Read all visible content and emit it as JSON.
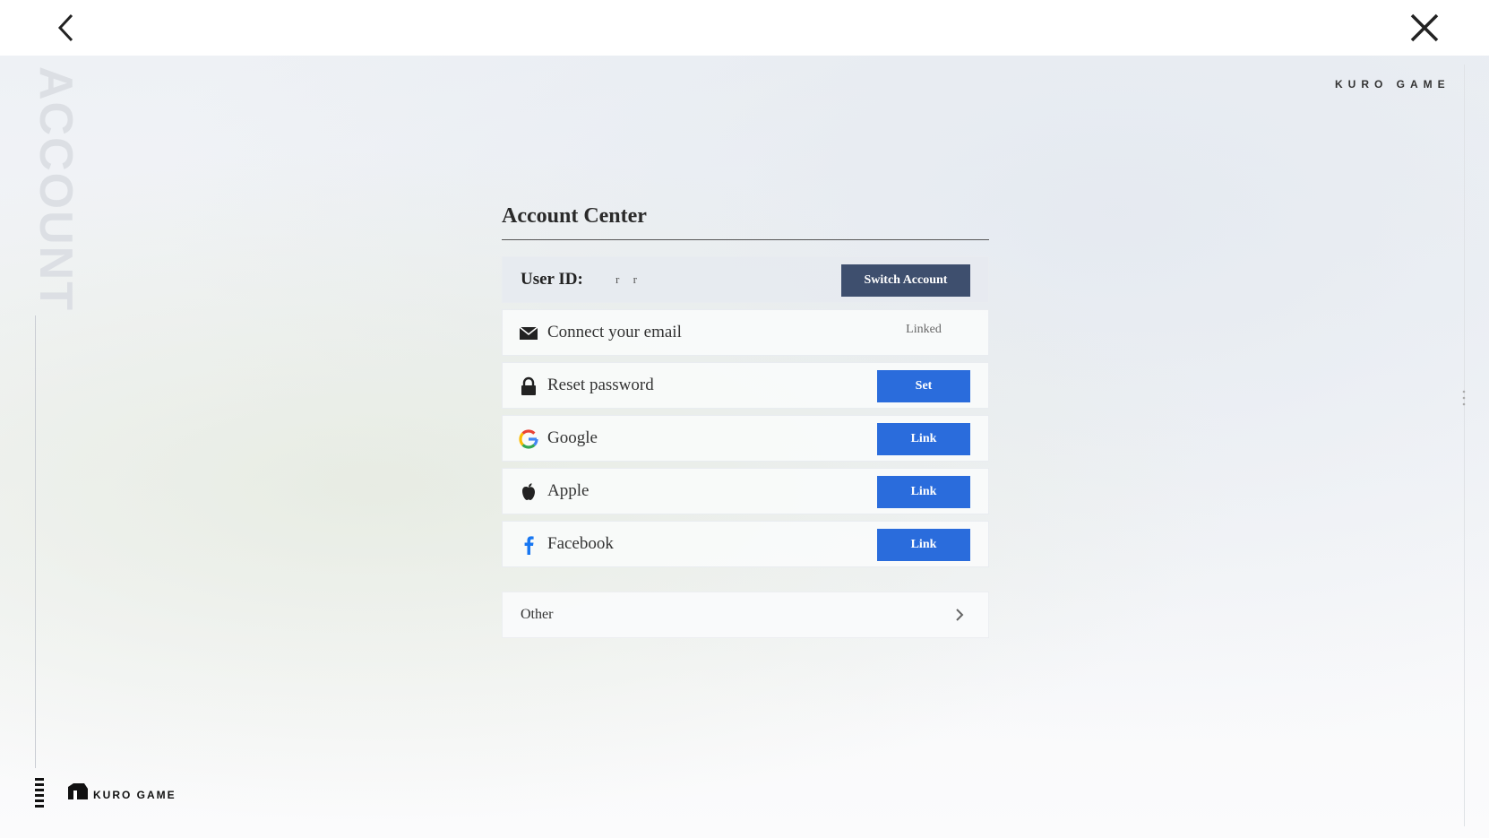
{
  "brand": {
    "top": "KURO GAME",
    "bottom": "KURO GAME",
    "watermark": "ACCOUNT"
  },
  "panel": {
    "title": "Account Center",
    "user": {
      "label": "User ID:",
      "value": "r  r",
      "switch_label": "Switch Account"
    },
    "rows": [
      {
        "icon": "mail-icon",
        "label": "Connect your email",
        "status": "Linked"
      },
      {
        "icon": "lock-icon",
        "label": "Reset password",
        "button": "Set"
      },
      {
        "icon": "google-icon",
        "label": "Google",
        "button": "Link"
      },
      {
        "icon": "apple-icon",
        "label": "Apple",
        "button": "Link"
      },
      {
        "icon": "facebook-icon",
        "label": "Facebook",
        "button": "Link"
      }
    ],
    "other": {
      "label": "Other"
    }
  },
  "colors": {
    "primary_button": "#2a6cdc",
    "dark_button": "#3e4f6e",
    "background": "#f3f5f8"
  }
}
